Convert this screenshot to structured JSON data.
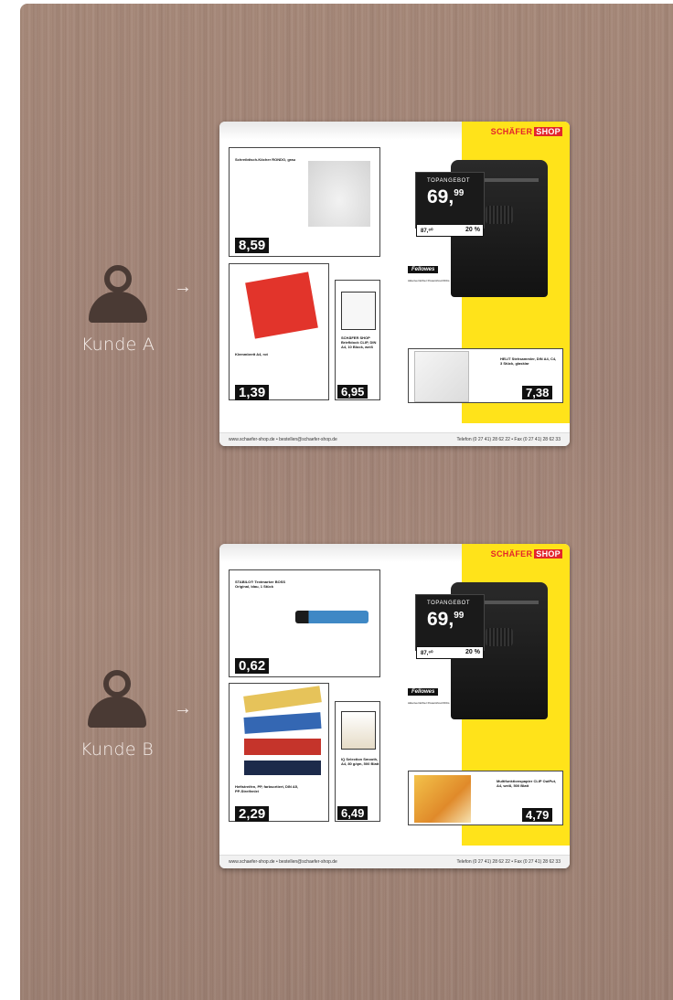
{
  "customers": [
    {
      "label": "Kunde A"
    },
    {
      "label": "Kunde B"
    }
  ],
  "arrow": "→",
  "catalog_a": {
    "brand": "SCHÄFER",
    "brand_suffix": "SHOP",
    "offer_label": "TOPANGEBOT",
    "offer_price": "69,",
    "offer_cents": "99",
    "old_price": "87,⁶⁰",
    "discount": "20 %",
    "fellowes": "Fellowes",
    "shredder_desc": "Aktenvernichter Powershred 60Cs",
    "item1_title": "Schreibtisch-Köcher RONDO, grau",
    "item1_price": "8,59",
    "item2_title": "Klemmbrett A4, rot",
    "item2_price": "1,39",
    "item3_title": "SCHÄFER SHOP Briefblock CLIP, DIN A4, 10 Block, weiß",
    "item3_price": "6,95",
    "item4_title": "HELIT Stehsammler, DIN A4, C4, 3 Stück, glasklar",
    "item4_price": "7,38",
    "footer_left": "www.schaefer-shop.de • bestellen@schaefer-shop.de",
    "footer_right": "Telefon (0 27 41) 28 62 22 • Fax (0 27 41) 28 62 33"
  },
  "catalog_b": {
    "brand": "SCHÄFER",
    "brand_suffix": "SHOP",
    "offer_label": "TOPANGEBOT",
    "offer_price": "69,",
    "offer_cents": "99",
    "old_price": "87,⁶⁰",
    "discount": "20 %",
    "fellowes": "Fellowes",
    "shredder_desc": "Aktenvernichter Powershred 60Cs",
    "item1_title": "STABILO® Textmarker BOSS Original, blau, 1 Stück",
    "item1_price": "0,62",
    "item2_title": "Heftstreifen, PP, farbsortiert, DIN A5, PP-Streifenlei",
    "item2_price": "2,29",
    "item3_title": "IQ Selection Smooth, A4, 80 g/qm, 500 Blatt",
    "item3_price": "6,49",
    "item4_title": "Multifunktionspapier CLIP OutPut, A4, weiß, 500 Blatt",
    "item4_price": "4,79",
    "footer_left": "www.schaefer-shop.de • bestellen@schaefer-shop.de",
    "footer_right": "Telefon (0 27 41) 28 62 22 • Fax (0 27 41) 28 62 33"
  }
}
